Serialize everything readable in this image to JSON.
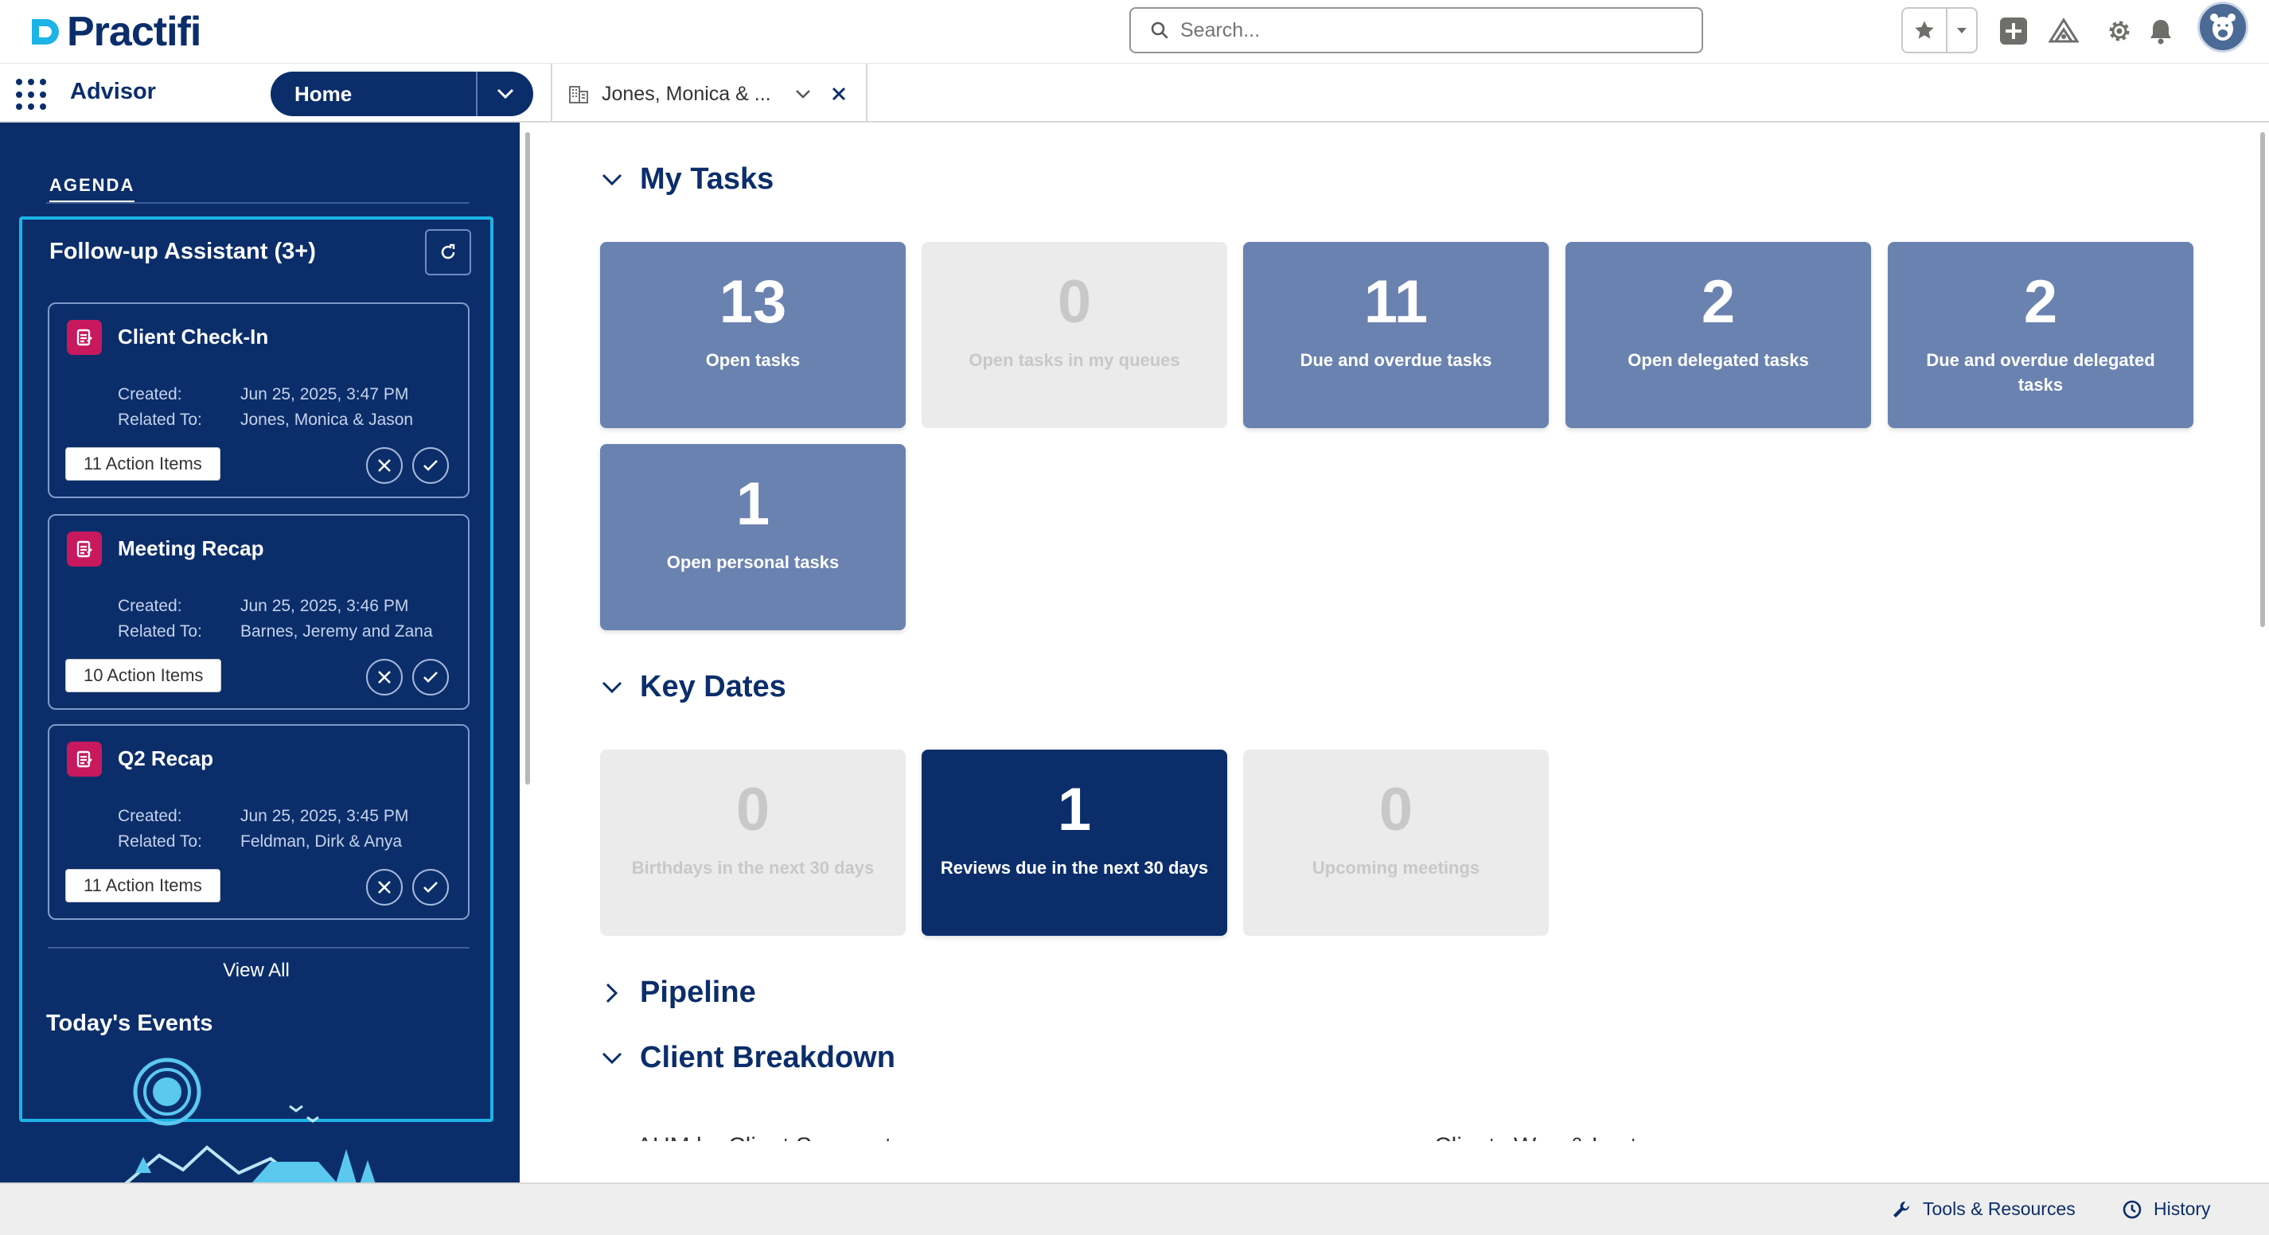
{
  "header": {
    "logo_text": "Practifi",
    "search": {
      "placeholder": "Search..."
    }
  },
  "nav": {
    "app_name": "Advisor",
    "home_label": "Home",
    "record_tab_label": "Jones, Monica & ..."
  },
  "sidebar": {
    "agenda_tab": "AGENDA",
    "followup_title": "Follow-up Assistant (3+)",
    "cards": [
      {
        "title": "Client Check-In",
        "created_label": "Created:",
        "created_value": "Jun 25, 2025, 3:47 PM",
        "related_label": "Related To:",
        "related_value": "Jones, Monica & Jason",
        "action_items": "11 Action Items"
      },
      {
        "title": "Meeting Recap",
        "created_label": "Created:",
        "created_value": "Jun 25, 2025, 3:46 PM",
        "related_label": "Related To:",
        "related_value": "Barnes, Jeremy and Zana",
        "action_items": "10 Action Items"
      },
      {
        "title": "Q2 Recap",
        "created_label": "Created:",
        "created_value": "Jun 25, 2025, 3:45 PM",
        "related_label": "Related To:",
        "related_value": "Feldman, Dirk & Anya",
        "action_items": "11 Action Items"
      }
    ],
    "view_all": "View All",
    "events_title": "Today's Events"
  },
  "main": {
    "my_tasks": {
      "title": "My Tasks",
      "tiles": [
        {
          "value": "13",
          "label": "Open tasks"
        },
        {
          "value": "0",
          "label": "Open tasks in my queues"
        },
        {
          "value": "11",
          "label": "Due and overdue tasks"
        },
        {
          "value": "2",
          "label": "Open delegated tasks"
        },
        {
          "value": "2",
          "label": "Due and overdue delegated tasks"
        },
        {
          "value": "1",
          "label": "Open personal tasks"
        }
      ]
    },
    "key_dates": {
      "title": "Key Dates",
      "tiles": [
        {
          "value": "0",
          "label": "Birthdays in the next 30 days"
        },
        {
          "value": "1",
          "label": "Reviews due in the next 30 days"
        },
        {
          "value": "0",
          "label": "Upcoming meetings"
        }
      ]
    },
    "pipeline_title": "Pipeline",
    "client_breakdown_title": "Client Breakdown",
    "cut_left": "AUM by Client Segment",
    "cut_right": "Clients Won & Lost"
  },
  "footer": {
    "tools_label": "Tools & Resources",
    "history_label": "History"
  },
  "colors": {
    "brand_navy": "#0b2e6b",
    "tile_blue": "#6a82b0",
    "tile_gray": "#ebebeb",
    "accent_cyan": "#1cb4e6",
    "task_icon_magenta": "#c8185e"
  }
}
